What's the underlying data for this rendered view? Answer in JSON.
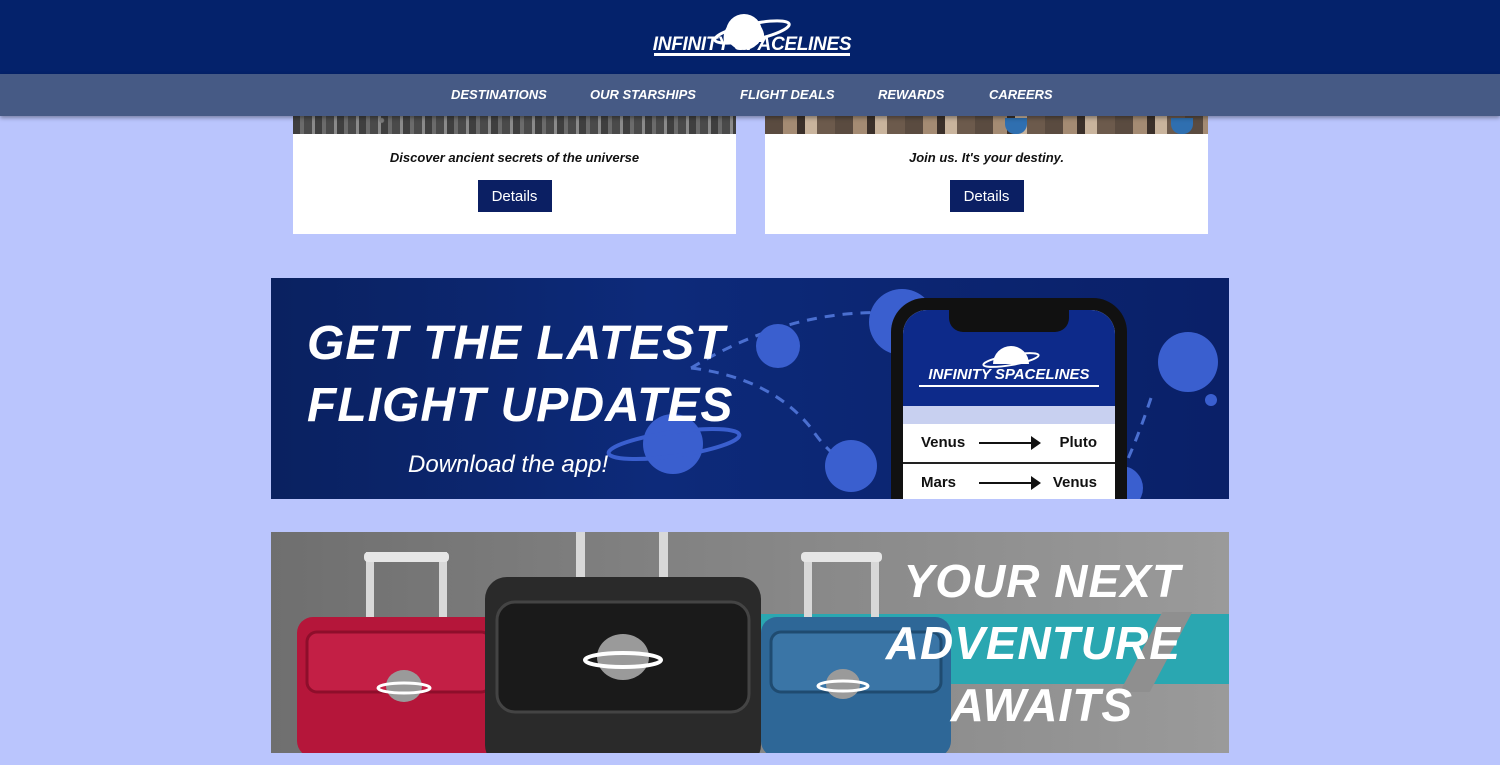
{
  "header": {
    "logo_text": "INFINITY SPACELINES"
  },
  "nav": {
    "items": [
      {
        "label": "DESTINATIONS"
      },
      {
        "label": "OUR STARSHIPS"
      },
      {
        "label": "FLIGHT DEALS"
      },
      {
        "label": "REWARDS"
      },
      {
        "label": "CAREERS"
      }
    ]
  },
  "cards": [
    {
      "caption": "Discover ancient secrets of the universe",
      "button_label": "Details"
    },
    {
      "caption": "Join us. It's your destiny.",
      "button_label": "Details"
    }
  ],
  "app_banner": {
    "headline_line1": "GET THE LATEST",
    "headline_line2": "FLIGHT UPDATES",
    "subtext": "Download the app!",
    "phone_logo": "INFINITY SPACELINES",
    "routes": [
      {
        "from": "Venus",
        "to": "Pluto"
      },
      {
        "from": "Mars",
        "to": "Venus"
      }
    ]
  },
  "luggage_banner": {
    "line1": "YOUR NEXT",
    "line2": "ADVENTURE",
    "line3": "AWAITS"
  },
  "colors": {
    "page_bg": "#bac5fd",
    "header_bg": "#04226b",
    "nav_bg": "#465a85",
    "button_bg": "#0b1f63",
    "teal": "#2aa7b1"
  }
}
